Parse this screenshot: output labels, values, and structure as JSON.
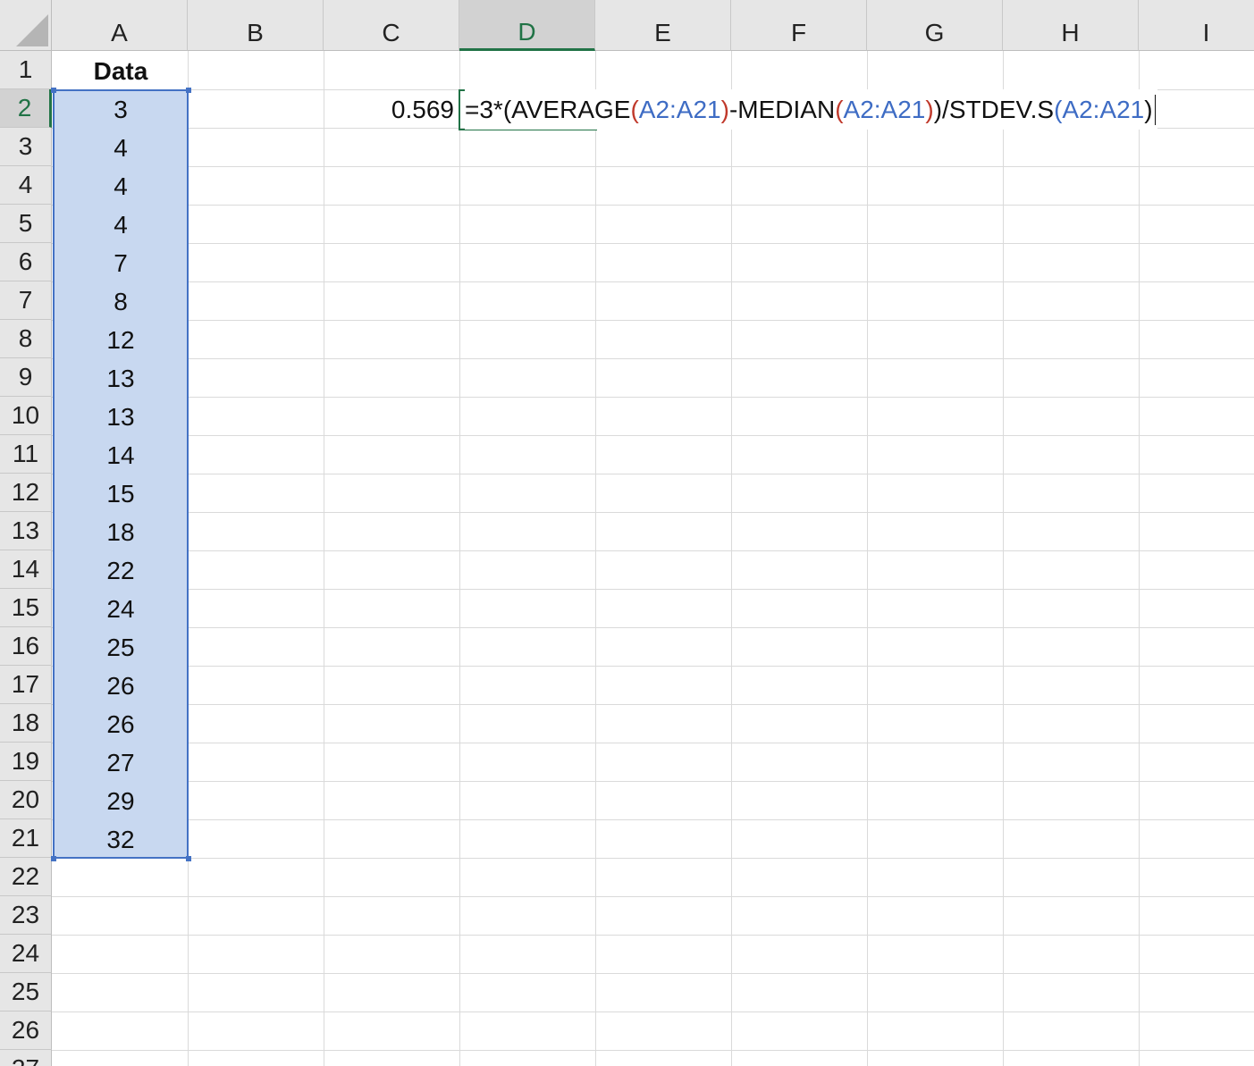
{
  "columns": [
    "A",
    "B",
    "C",
    "D",
    "E",
    "F",
    "G",
    "H",
    "I"
  ],
  "rows": [
    "1",
    "2",
    "3",
    "4",
    "5",
    "6",
    "7",
    "8",
    "9",
    "10",
    "11",
    "12",
    "13",
    "14",
    "15",
    "16",
    "17",
    "18",
    "19",
    "20",
    "21",
    "22",
    "23",
    "24",
    "25",
    "26",
    "27"
  ],
  "active_column": "D",
  "active_row": "2",
  "column_a": {
    "header": "Data",
    "values": [
      "3",
      "4",
      "4",
      "4",
      "7",
      "8",
      "12",
      "13",
      "13",
      "14",
      "15",
      "18",
      "22",
      "24",
      "25",
      "26",
      "26",
      "27",
      "29",
      "32"
    ]
  },
  "cell_c2": "0.569",
  "formula": {
    "p1": "=3*(AVERAGE",
    "p2": "(",
    "p3": "A2:A21",
    "p4": ")",
    "p5": "-MEDIAN",
    "p6": "(",
    "p7": "A2:A21",
    "p8": ")",
    "p9": ")/STDEV.S",
    "p10": "(",
    "p11": "A2:A21",
    "p12": ")"
  },
  "colors": {
    "accent_green": "#217346",
    "selection_fill": "#c8d8f0",
    "selection_border": "#4472c4",
    "ref_blue": "#3e6cc4",
    "ref_red": "#c0392b"
  },
  "icons": {
    "select_all": "select-all-triangle-icon"
  }
}
